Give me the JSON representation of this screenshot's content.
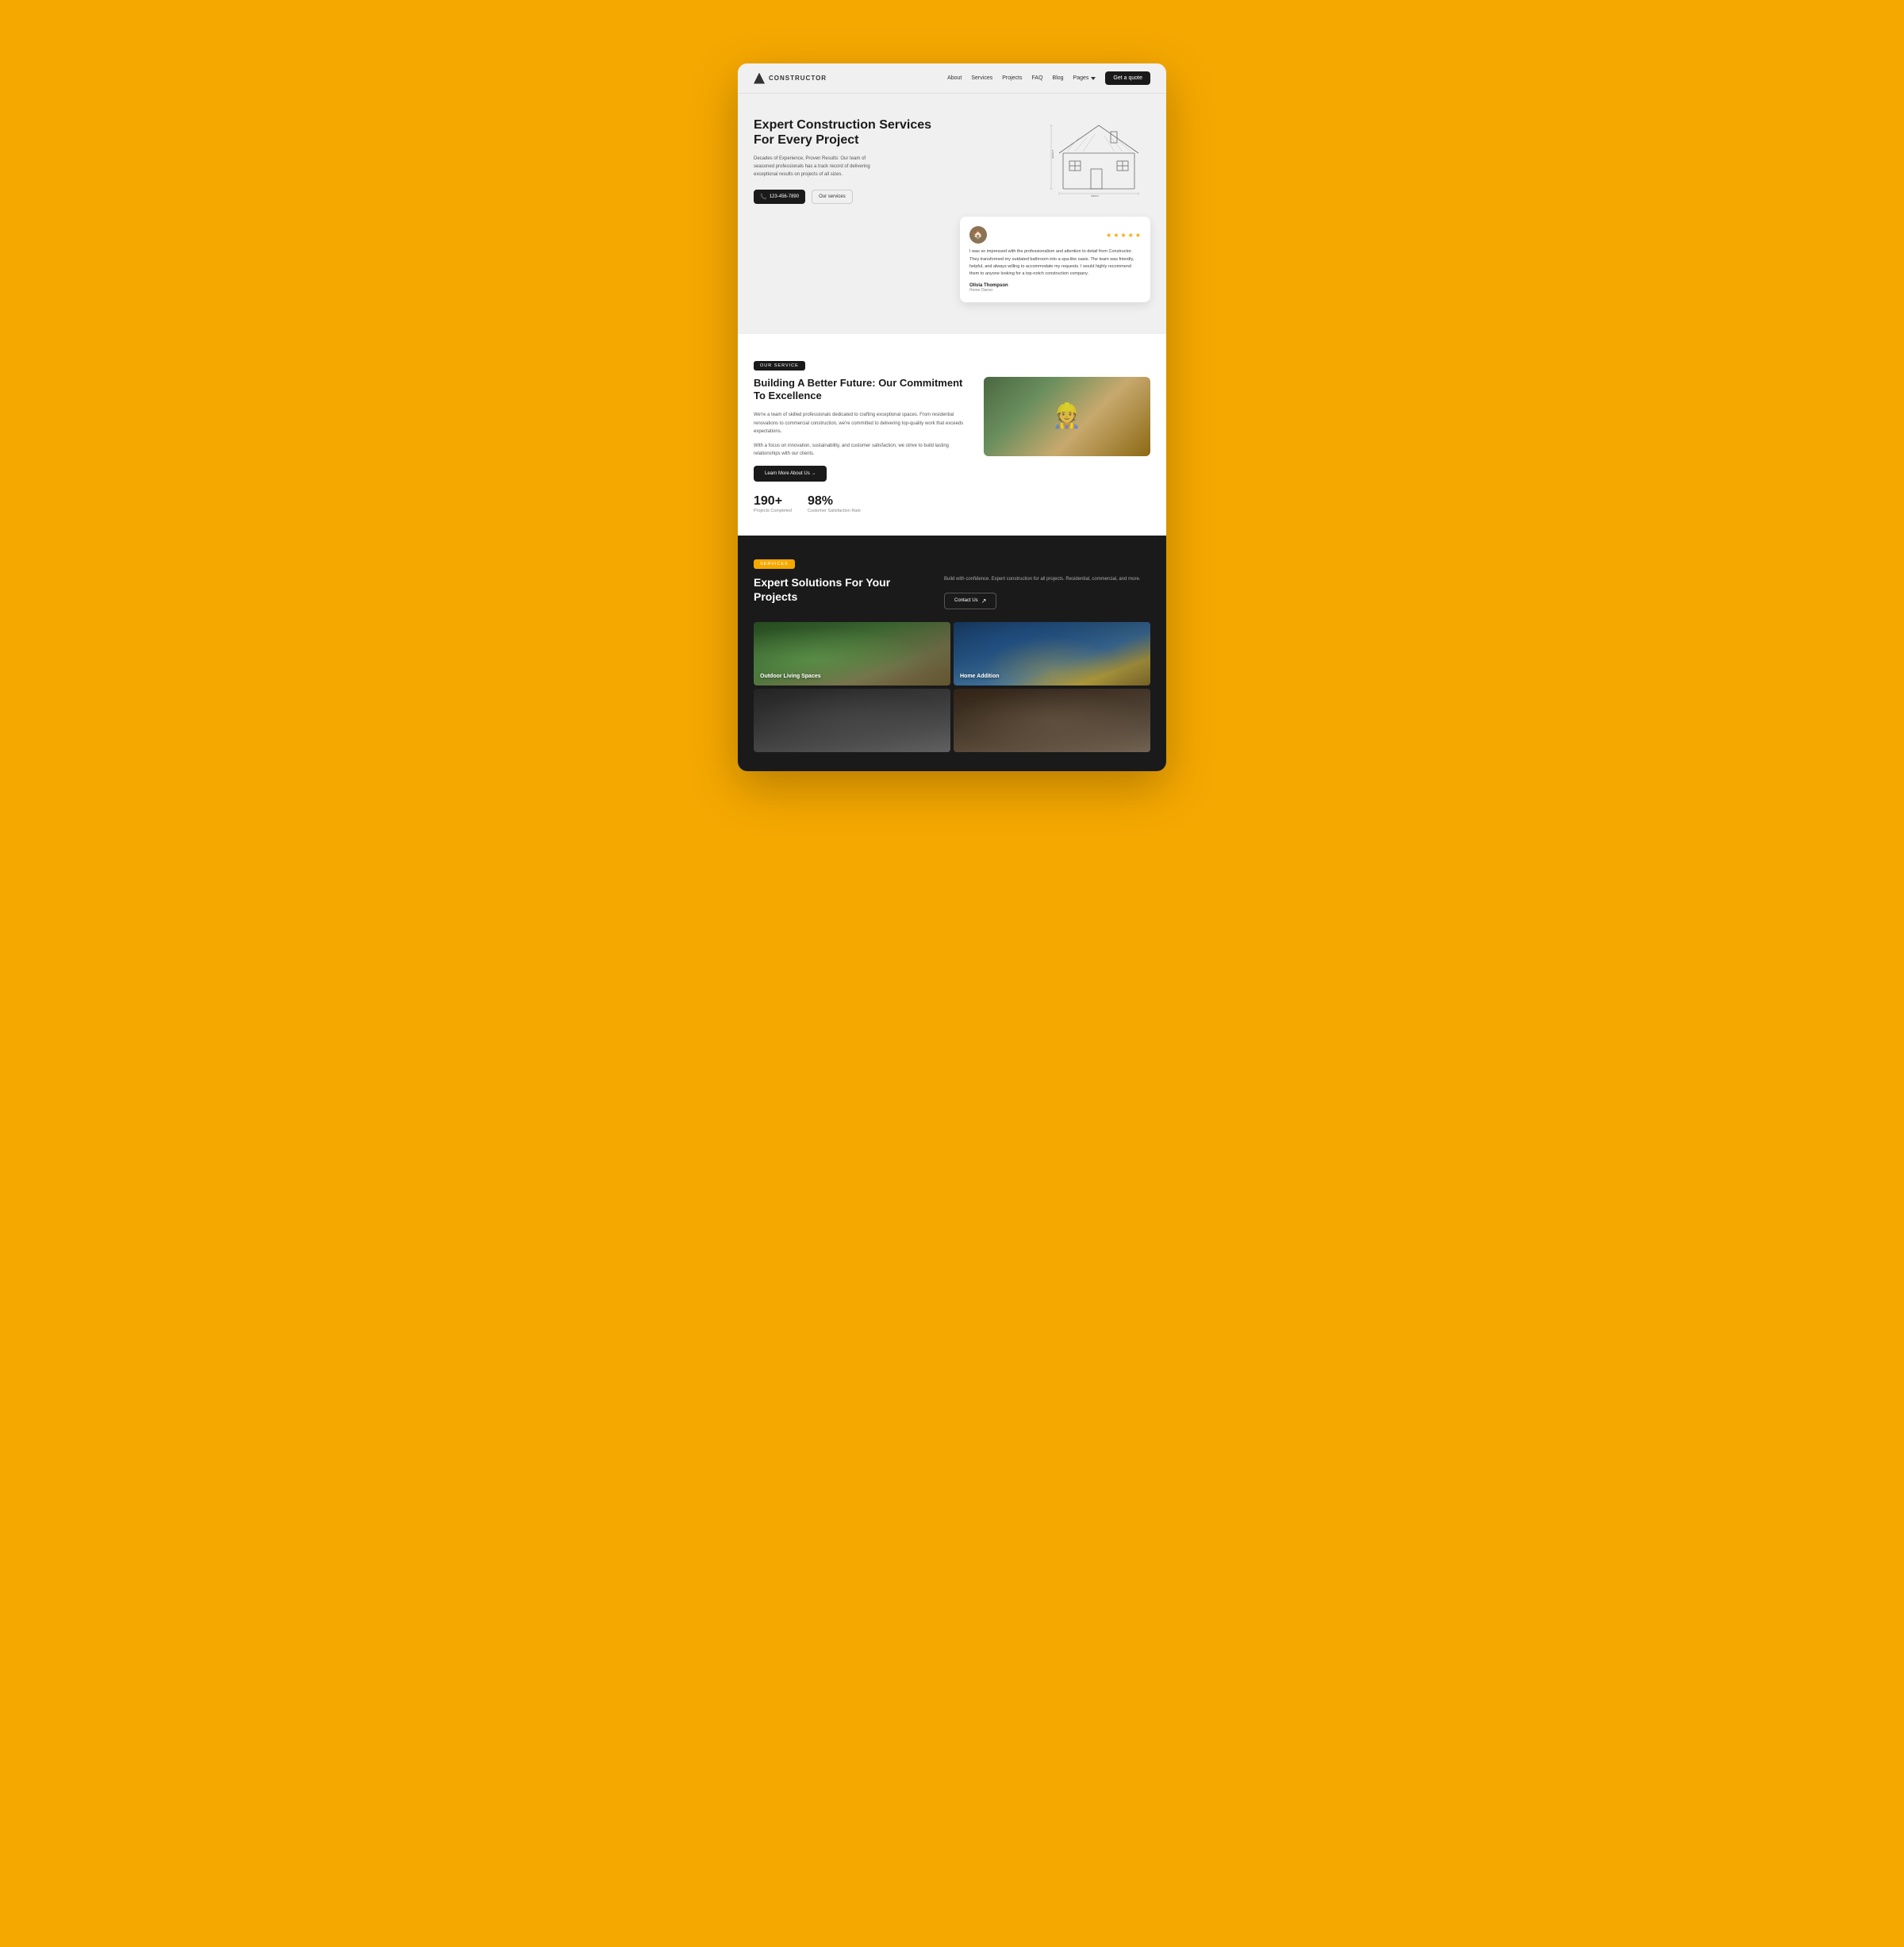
{
  "brand": {
    "name": "CONSTRUCTOR"
  },
  "navbar": {
    "links": [
      "About",
      "Services",
      "Projects",
      "FAQ",
      "Blog"
    ],
    "pages_label": "Pages",
    "cta_label": "Get a quote"
  },
  "hero": {
    "title": "Expert Construction Services For Every Project",
    "subtitle": "Decades of Experience, Proven Results: Our team of seasoned professionals has a track record of delivering exceptional results on projects of all sizes.",
    "phone": "123-456-7890",
    "services_btn": "Our services"
  },
  "testimonial": {
    "text": "I was so impressed with the professionalism and attention to detail from Constructor. They transformed my outdated bathroom into a spa-like oasis. The team was friendly, helpful, and always willing to accommodate my requests. I would highly recommend them to anyone looking for a top-notch construction company.",
    "author": "Olivia Thompson",
    "role": "Home Owner",
    "stars": 5
  },
  "about": {
    "badge": "Our service",
    "title": "Building A Better Future: Our Commitment To Excellence",
    "text1": "We're a team of skilled professionals dedicated to crafting exceptional spaces. From residential renovations to commercial construction, we're committed to delivering top-quality work that exceeds expectations.",
    "text2": "With a focus on innovation, sustainability, and customer satisfaction, we strive to build lasting relationships with our clients.",
    "learn_more_btn": "Learn More About Us →",
    "stats": [
      {
        "number": "190+",
        "label": "Projects Completed"
      },
      {
        "number": "98%",
        "label": "Customer Satisfaction Rate"
      }
    ]
  },
  "services": {
    "badge": "Services",
    "title": "Expert Solutions For Your Projects",
    "description": "Build with confidence. Expert construction for all projects. Residential, commercial, and more.",
    "contact_btn": "Contact Us",
    "projects": [
      {
        "id": "outdoor",
        "label": "Outdoor Living Spaces"
      },
      {
        "id": "home-addition",
        "label": "Home Addition"
      },
      {
        "id": "bottom-left",
        "label": ""
      },
      {
        "id": "bottom-right",
        "label": ""
      }
    ]
  }
}
